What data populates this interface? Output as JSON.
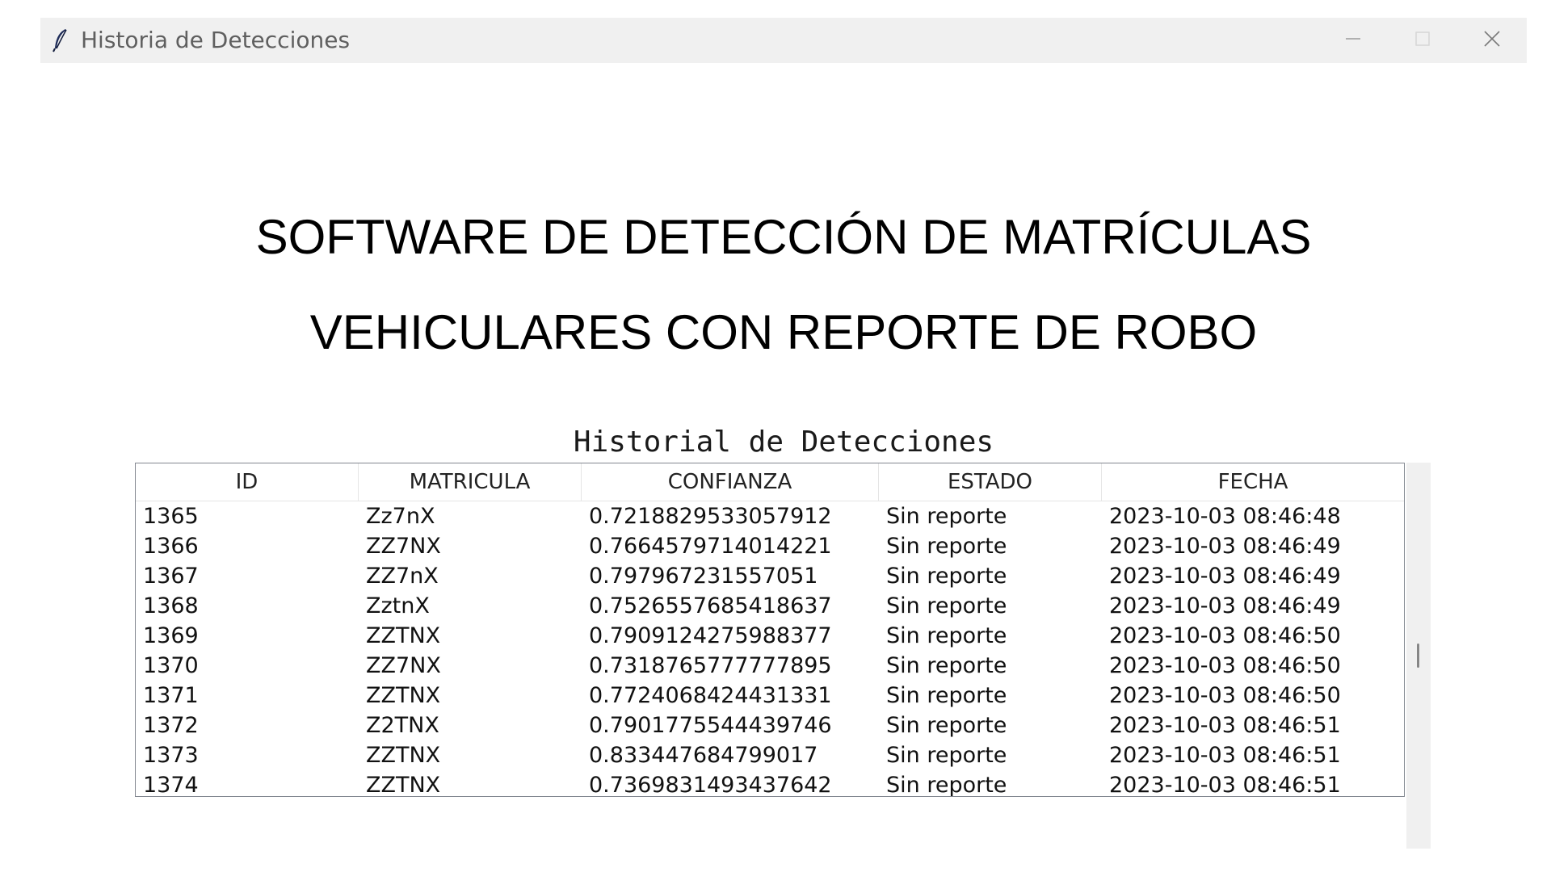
{
  "window": {
    "title": "Historia de Detecciones",
    "icon": "feather-icon",
    "controls": {
      "minimize": "minimize-icon",
      "maximize": "maximize-icon",
      "close": "close-icon"
    }
  },
  "heading": {
    "line1": "SOFTWARE DE DETECCIÓN DE MATRÍCULAS",
    "line2": "VEHICULARES CON REPORTE DE ROBO"
  },
  "subtitle": "Historial de Detecciones",
  "table": {
    "columns": [
      "ID",
      "MATRICULA",
      "CONFIANZA",
      "ESTADO",
      "FECHA"
    ],
    "rows": [
      [
        "1365",
        "Zz7nX",
        "0.7218829533057912",
        "Sin reporte",
        "2023-10-03 08:46:48"
      ],
      [
        "1366",
        "ZZ7NX",
        "0.7664579714014221",
        "Sin reporte",
        "2023-10-03 08:46:49"
      ],
      [
        "1367",
        "ZZ7nX",
        "0.797967231557051",
        "Sin reporte",
        "2023-10-03 08:46:49"
      ],
      [
        "1368",
        "ZztnX",
        "0.7526557685418637",
        "Sin reporte",
        "2023-10-03 08:46:49"
      ],
      [
        "1369",
        "ZZTNX",
        "0.7909124275988377",
        "Sin reporte",
        "2023-10-03 08:46:50"
      ],
      [
        "1370",
        "ZZ7NX",
        "0.7318765777777895",
        "Sin reporte",
        "2023-10-03 08:46:50"
      ],
      [
        "1371",
        "ZZTNX",
        "0.7724068424431331",
        "Sin reporte",
        "2023-10-03 08:46:50"
      ],
      [
        "1372",
        "Z2TNX",
        "0.7901775544439746",
        "Sin reporte",
        "2023-10-03 08:46:51"
      ],
      [
        "1373",
        "ZZTNX",
        "0.833447684799017",
        "Sin reporte",
        "2023-10-03 08:46:51"
      ],
      [
        "1374",
        "ZZTNX",
        "0.7369831493437642",
        "Sin reporte",
        "2023-10-03 08:46:51"
      ]
    ]
  },
  "colors": {
    "titlebar_bg": "#f0f0f0",
    "title_text": "#5f5f5f",
    "table_border": "#828790",
    "scrollbar_bg": "#f0f0f0"
  }
}
